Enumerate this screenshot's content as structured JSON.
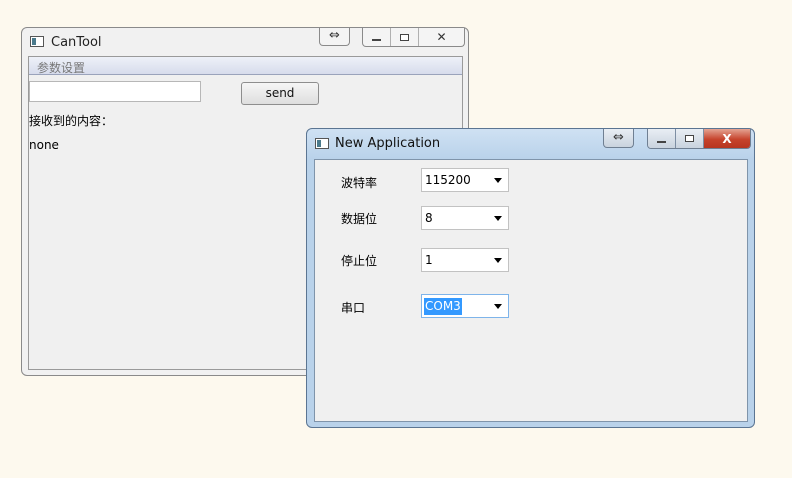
{
  "cantool": {
    "title": "CanTool",
    "expand_glyph": "⇔",
    "close_glyph": "✕",
    "menu_tab": "参数设置",
    "send_input_value": "",
    "send_button": "send",
    "received_label": "接收到的内容：",
    "received_value": "none",
    "icons": [
      "app-icon",
      "expand-icon",
      "minimize-icon",
      "maximize-icon",
      "close-icon"
    ]
  },
  "newapp": {
    "title": "New Application",
    "expand_glyph": "⇔",
    "close_glyph": "X",
    "fields": [
      {
        "label": "波特率",
        "value": "115200"
      },
      {
        "label": "数据位",
        "value": "8"
      },
      {
        "label": "停止位",
        "value": "1"
      },
      {
        "label": "串口",
        "value": "COM3"
      }
    ],
    "icons": [
      "app-icon",
      "expand-icon",
      "minimize-icon",
      "maximize-icon",
      "close-icon",
      "dropdown-arrow-icon"
    ]
  },
  "colors": {
    "desktop_bg": "#fdf9ee",
    "active_titlebar": "#b9d2ea",
    "close_button_active": "#c6432c",
    "selection_highlight": "#3399ff"
  }
}
